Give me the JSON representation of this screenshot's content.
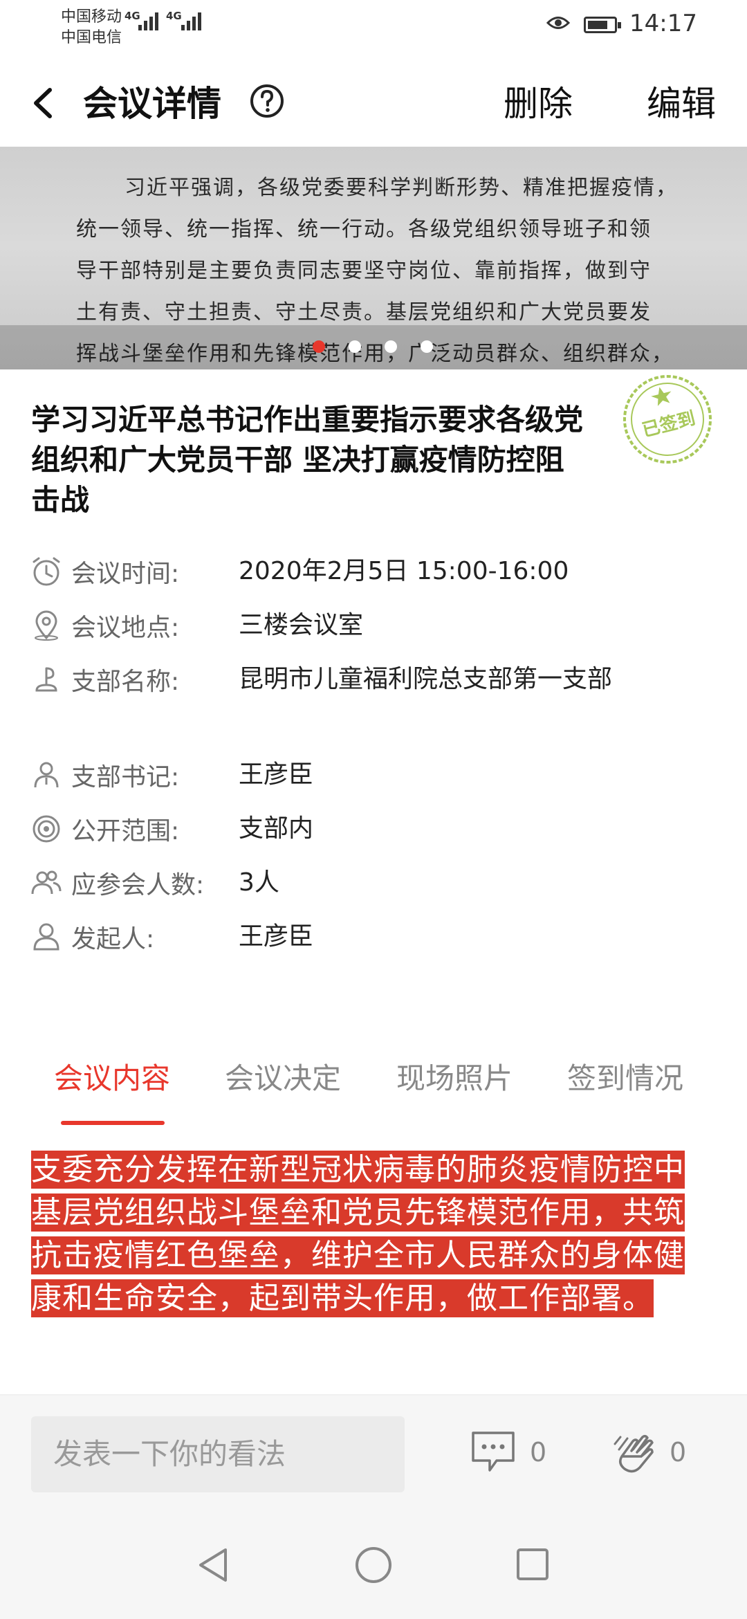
{
  "status_bar": {
    "carrier_1": "中国移动",
    "carrier_2": "中国电信",
    "network_1": "4G",
    "network_2": "4G",
    "time": "14:17"
  },
  "header": {
    "title": "会议详情",
    "delete_label": "删除",
    "edit_label": "编辑",
    "help_icon": "question-circle-icon"
  },
  "banner": {
    "lines": [
      "习近平强调，各级党委要科学判断形势、精准把握疫情，",
      "统一领导、统一指挥、统一行动。各级党组织领导班子和领",
      "导干部特别是主要负责同志要坚守岗位、靠前指挥，做到守",
      "土有责、守土担责、守土尽责。基层党组织和广大党员要发",
      "挥战斗堡垒作用和先锋模范作用，广泛动员群众、组织群众，"
    ],
    "slide_count": 4,
    "active_slide": 1
  },
  "meeting": {
    "title": "学习习近平总书记作出重要指示要求各级党组织和广大党员干部 坚决打赢疫情防控阻击战",
    "stamp_text": "已签到",
    "fields": [
      {
        "icon": "clock-icon",
        "label": "会议时间:",
        "value": "2020年2月5日 15:00-16:00"
      },
      {
        "icon": "location-pin-icon",
        "label": "会议地点:",
        "value": "三楼会议室"
      },
      {
        "icon": "branch-icon",
        "label": "支部名称:",
        "value": "昆明市儿童福利院总支部第一支部"
      },
      {
        "icon": "person-icon",
        "label": "支部书记:",
        "value": "王彦臣"
      },
      {
        "icon": "target-icon",
        "label": "公开范围:",
        "value": "支部内"
      },
      {
        "icon": "people-icon",
        "label": "应参会人数:",
        "value": "3人"
      },
      {
        "icon": "user-icon",
        "label": "发起人:",
        "value": "王彦臣"
      }
    ]
  },
  "tabs": [
    {
      "label": "会议内容",
      "active": true
    },
    {
      "label": "会议决定",
      "active": false
    },
    {
      "label": "现场照片",
      "active": false
    },
    {
      "label": "签到情况",
      "active": false
    }
  ],
  "content": {
    "text": "支委充分发挥在新型冠状病毒的肺炎疫情防控中基层党组织战斗堡垒和党员先锋模范作用，共筑抗击疫情红色堡垒，维护全市人民群众的身体健康和生命安全，起到带头作用，做工作部署。"
  },
  "comment_bar": {
    "placeholder": "发表一下你的看法",
    "comment_count": "0",
    "like_count": "0"
  },
  "colors": {
    "accent": "#e8372c",
    "highlight": "#d93a2b",
    "stamp": "#a8c85a"
  }
}
